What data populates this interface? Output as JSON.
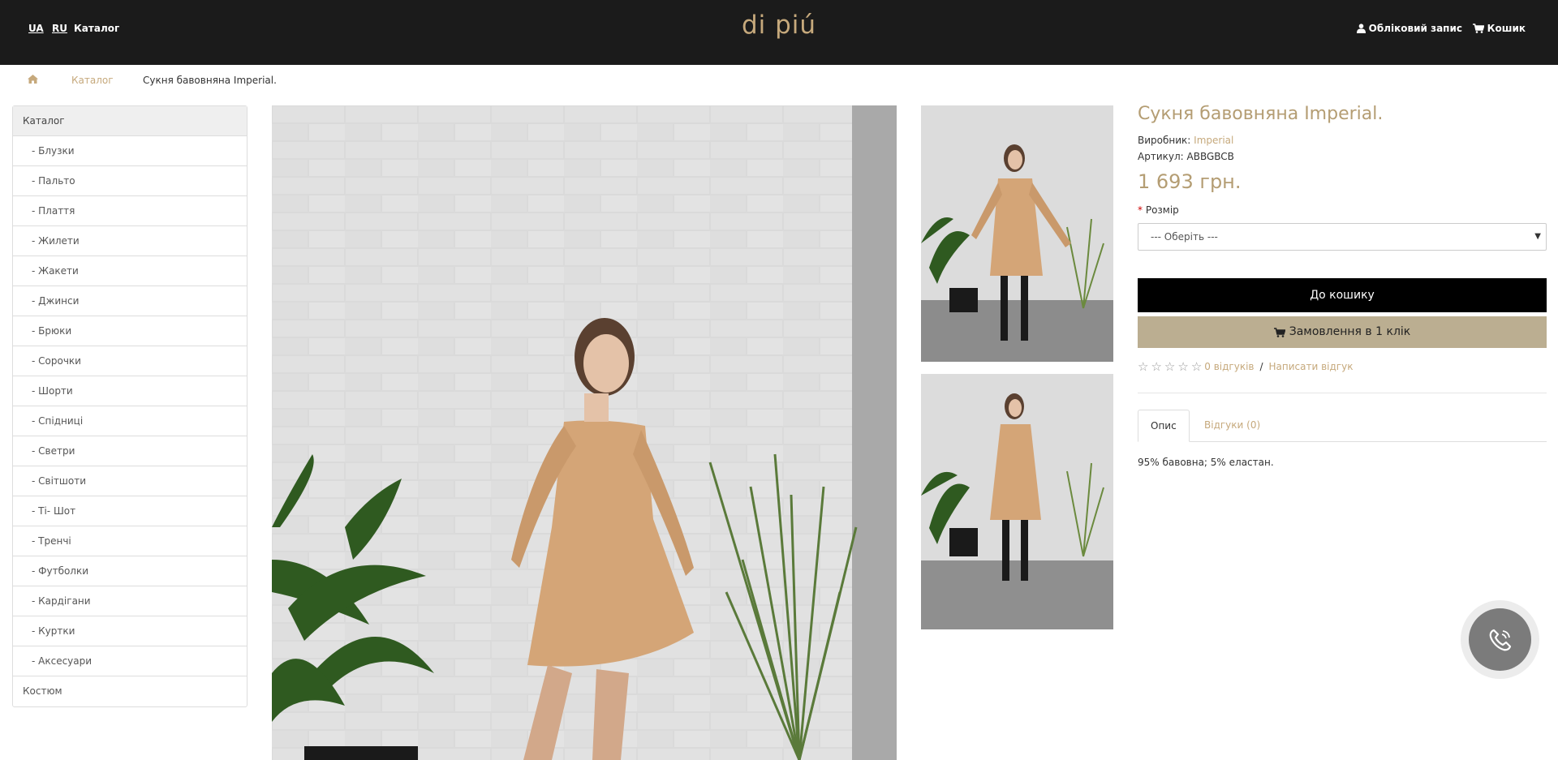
{
  "header": {
    "lang_ua": "UA",
    "lang_ru": "RU",
    "catalog": "Каталог",
    "logo": "di piú",
    "account": "Обліковий запис",
    "cart": "Кошик"
  },
  "breadcrumb": {
    "catalog": "Каталог",
    "current": "Сукня бавовняна Imperial."
  },
  "sidebar": {
    "items": [
      {
        "label": "Каталог"
      },
      {
        "label": "- Блузки"
      },
      {
        "label": "- Пальто"
      },
      {
        "label": "- Плаття"
      },
      {
        "label": "- Жилети"
      },
      {
        "label": "- Жакети"
      },
      {
        "label": "- Джинси"
      },
      {
        "label": "- Брюки"
      },
      {
        "label": "- Сорочки"
      },
      {
        "label": "- Шорти"
      },
      {
        "label": "- Спідниці"
      },
      {
        "label": "- Светри"
      },
      {
        "label": "- Світшоти"
      },
      {
        "label": "- Ті- Шот"
      },
      {
        "label": "- Тренчі"
      },
      {
        "label": "- Футболки"
      },
      {
        "label": "- Кардігани"
      },
      {
        "label": "- Куртки"
      },
      {
        "label": "- Аксесуари"
      },
      {
        "label": "Костюм"
      }
    ]
  },
  "product": {
    "title": "Сукня бавовняна Imperial.",
    "manufacturer_label": "Виробник:",
    "manufacturer": "Imperial",
    "sku_label": "Артикул:",
    "sku": "ABBGBCB",
    "price": "1 693 грн.",
    "size_required": "*",
    "size_label": "Розмір",
    "size_placeholder": "--- Оберіть ---",
    "add_to_cart": "До кошику",
    "one_click": "Замовлення в 1 клік",
    "rating": 0,
    "reviews_count": "0 відгуків",
    "write_review": "Написати відгук",
    "tab_description": "Опис",
    "tab_reviews": "Відгуки (0)",
    "description": "95% бавовна; 5% еластан."
  },
  "colors": {
    "accent": "#c6a97c",
    "header_bg": "#1b1b1b",
    "one_click_bg": "#bbae91"
  }
}
